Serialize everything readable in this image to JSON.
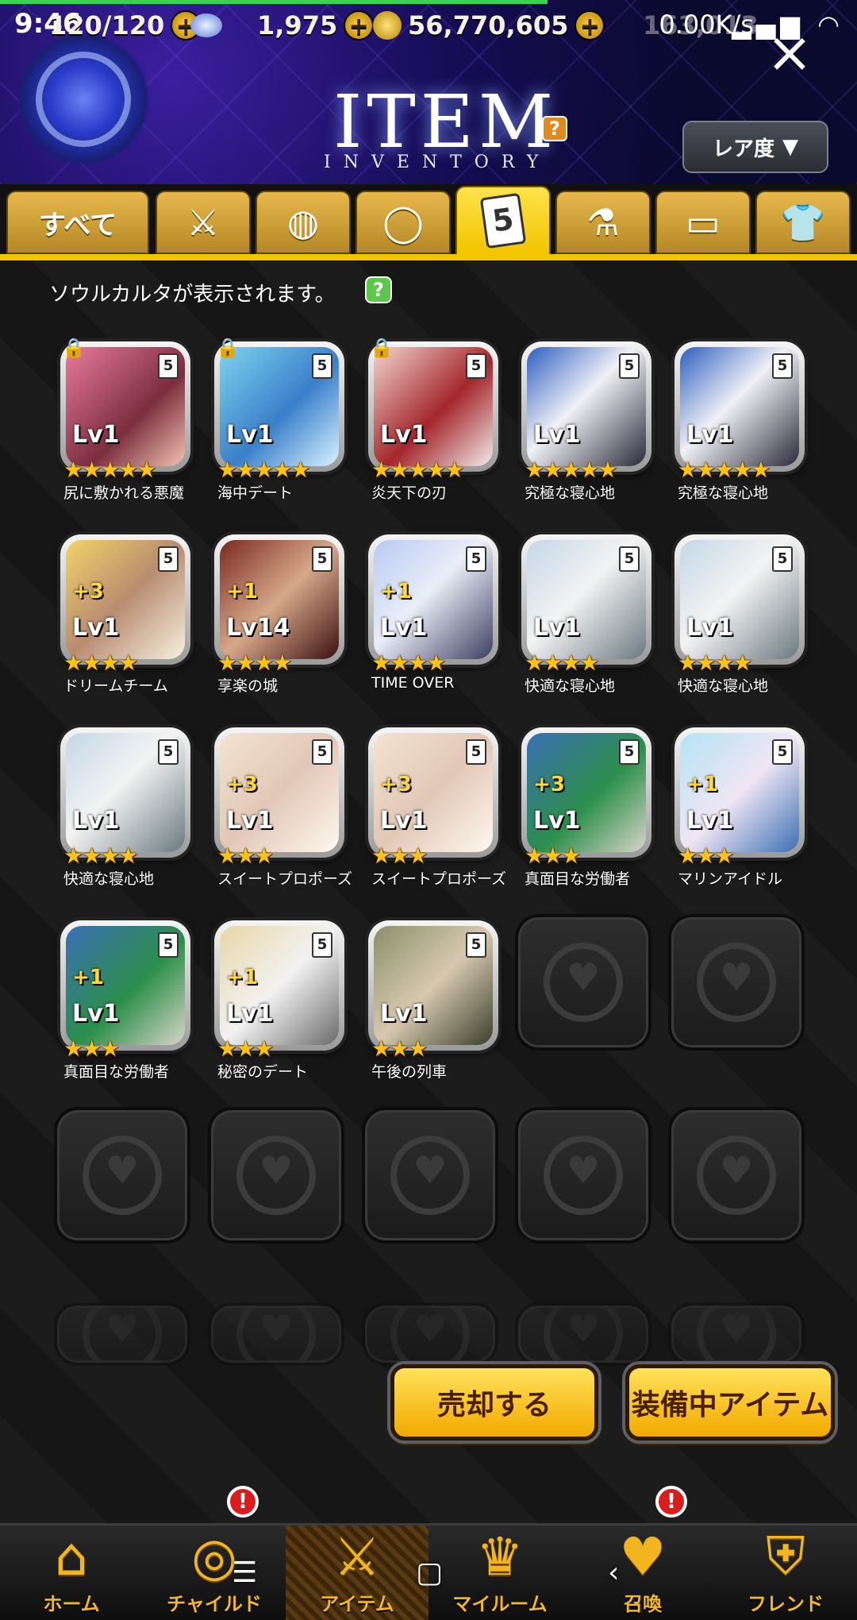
{
  "status": {
    "time": "9:46",
    "network_speed": "0.00K/s",
    "stamina": "120/120",
    "gems": "1,975",
    "gold": "56,770,605",
    "other": "163,013"
  },
  "header": {
    "title": "ITEM",
    "subtitle": "INVENTORY",
    "help": "?",
    "sort_label": "レア度"
  },
  "tabs": {
    "all_label": "すべて",
    "soul_card_glyph": "5"
  },
  "info": {
    "message": "ソウルカルタが表示されます。",
    "help": "?"
  },
  "cards": [
    {
      "name": "尻に敷かれる悪魔",
      "level": "Lv1",
      "plus": "",
      "stars": "★★★★★",
      "locked": true,
      "art": "linear-gradient(135deg,#e97aa0,#7b2e3e 60%,#f1c3b0)"
    },
    {
      "name": "海中デート",
      "level": "Lv1",
      "plus": "",
      "stars": "★★★★★",
      "locked": true,
      "art": "linear-gradient(135deg,#7fd3f0,#3a7fc9 55%,#d9f3ff)"
    },
    {
      "name": "炎天下の刃",
      "level": "Lv1",
      "plus": "",
      "stars": "★★★★★",
      "locked": true,
      "art": "linear-gradient(135deg,#f3d6cf,#a3262b 55%,#f0ece8)"
    },
    {
      "name": "究極な寝心地",
      "level": "Lv1",
      "plus": "",
      "stars": "★★★★★",
      "locked": false,
      "art": "linear-gradient(135deg,#2d5fbf,#f0f0f6 45%,#2a2a3a)"
    },
    {
      "name": "究極な寝心地",
      "level": "Lv1",
      "plus": "",
      "stars": "★★★★★",
      "locked": false,
      "art": "linear-gradient(135deg,#2d5fbf,#f0f0f6 45%,#2a2a3a)"
    },
    {
      "name": "ドリームチーム",
      "level": "Lv1",
      "plus": "+3",
      "stars": "★★★★",
      "locked": false,
      "art": "linear-gradient(135deg,#f3d36a,#b88c70 50%,#f6f0e0)"
    },
    {
      "name": "享楽の城",
      "level": "Lv14",
      "plus": "+1",
      "stars": "★★★★",
      "locked": false,
      "art": "linear-gradient(135deg,#7a2a20,#d6a88a 50%,#3b1010)"
    },
    {
      "name": "TIME OVER",
      "level": "Lv1",
      "plus": "+1",
      "stars": "★★★★",
      "locked": false,
      "art": "linear-gradient(135deg,#b9c9f2,#e9eef8 45%,#3d3f60)"
    },
    {
      "name": "快適な寝心地",
      "level": "Lv1",
      "plus": "",
      "stars": "★★★★",
      "locked": false,
      "art": "linear-gradient(135deg,#c5d7e6,#f3f3f3 45%,#6a7a80)"
    },
    {
      "name": "快適な寝心地",
      "level": "Lv1",
      "plus": "",
      "stars": "★★★★",
      "locked": false,
      "art": "linear-gradient(135deg,#c5d7e6,#f3f3f3 45%,#6a7a80)"
    },
    {
      "name": "快適な寝心地",
      "level": "Lv1",
      "plus": "",
      "stars": "★★★★",
      "locked": false,
      "art": "linear-gradient(135deg,#c5d7e6,#f3f3f3 45%,#6a7a80)"
    },
    {
      "name": "スイートプロポーズ",
      "level": "Lv1",
      "plus": "+3",
      "stars": "★★★",
      "locked": false,
      "art": "linear-gradient(135deg,#f4e3d0,#e2c7b6 50%,#fff8f0)"
    },
    {
      "name": "スイートプロポーズ",
      "level": "Lv1",
      "plus": "+3",
      "stars": "★★★",
      "locked": false,
      "art": "linear-gradient(135deg,#f4e3d0,#e2c7b6 50%,#fff8f0)"
    },
    {
      "name": "真面目な労働者",
      "level": "Lv1",
      "plus": "+3",
      "stars": "★★★",
      "locked": false,
      "art": "linear-gradient(135deg,#3b6fb5,#2c8f4a 55%,#d9d4c8)"
    },
    {
      "name": "マリンアイドル",
      "level": "Lv1",
      "plus": "+1",
      "stars": "★★★",
      "locked": false,
      "art": "linear-gradient(135deg,#b4e3f5,#f0e6f4 50%,#3b6fb5)"
    },
    {
      "name": "真面目な労働者",
      "level": "Lv1",
      "plus": "+1",
      "stars": "★★★",
      "locked": false,
      "art": "linear-gradient(135deg,#3b6fb5,#2c8f4a 55%,#d9d4c8)"
    },
    {
      "name": "秘密のデート",
      "level": "Lv1",
      "plus": "+1",
      "stars": "★★★",
      "locked": false,
      "art": "linear-gradient(135deg,#e8d6a8,#f2f2f2 50%,#6a6a6a)"
    },
    {
      "name": "午後の列車",
      "level": "Lv1",
      "plus": "",
      "stars": "★★★",
      "locked": false,
      "art": "linear-gradient(135deg,#8a8f6a,#d8c8b0 50%,#3a3f2a)"
    }
  ],
  "buttons": {
    "sell": "売却する",
    "equipped": "装備中アイテム"
  },
  "nav": [
    {
      "label": "ホーム",
      "icon": "home-icon",
      "glyph": "⌂",
      "alert": false
    },
    {
      "label": "チャイルド",
      "icon": "child-icon",
      "glyph": "◎",
      "alert": true
    },
    {
      "label": "アイテム",
      "icon": "item-icon",
      "glyph": "⚔",
      "alert": false
    },
    {
      "label": "マイルーム",
      "icon": "myroom-icon",
      "glyph": "♛",
      "alert": false
    },
    {
      "label": "召喚",
      "icon": "summon-icon",
      "glyph": "♥",
      "alert": true
    },
    {
      "label": "フレンド",
      "icon": "friend-icon",
      "glyph": "⛨",
      "alert": false
    }
  ],
  "alert_glyph": "!",
  "colors": {
    "accent_gold": "#f4c400",
    "alert_red": "#d91d1d",
    "star": "#ffc21a"
  }
}
